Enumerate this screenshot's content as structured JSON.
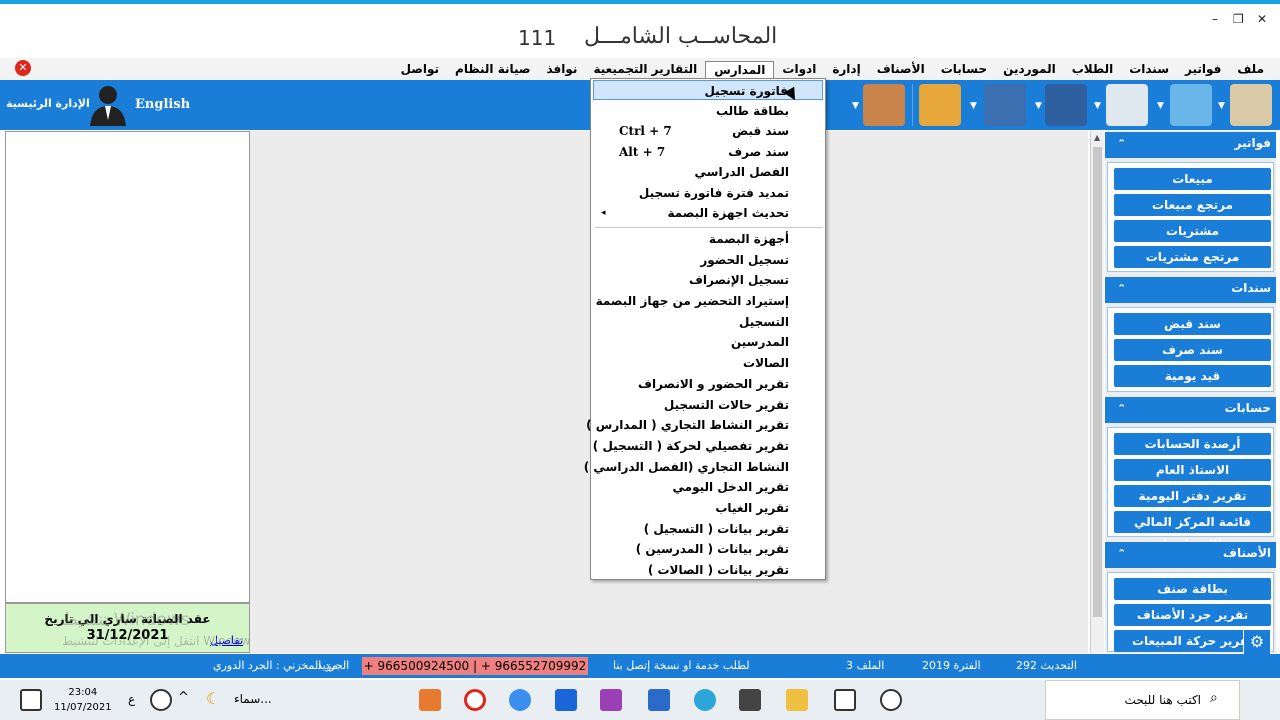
{
  "window": {
    "title": "المحاســب الشامـــل",
    "number": "111",
    "ctl_min": "–",
    "ctl_restore": "❐",
    "ctl_close": "✕"
  },
  "menubar": [
    "ملف",
    "فواتير",
    "سندات",
    "الطلاب",
    "الموردين",
    "حسابات",
    "الأصناف",
    "إدارة",
    "ادوات",
    "المدارس",
    "التقارير التجميعية",
    "نوافذ",
    "صيانة النظام",
    "تواصل"
  ],
  "active_menu": "المدارس",
  "toolbar": {
    "home_label": "الإدارة الرئيسية",
    "lang_label": "English"
  },
  "dropdown": {
    "items": [
      {
        "label": "فاتورة تسجيل",
        "highlighted": true
      },
      {
        "label": "بطاقة طالب"
      },
      {
        "label": "سند قبض",
        "shortcut": "Ctrl + 7"
      },
      {
        "label": "سند صرف",
        "shortcut": "Alt + 7"
      },
      {
        "label": "الفصل الدراسي"
      },
      {
        "label": "تمديد فترة فاتورة تسجيل"
      },
      {
        "label": "تحديث اجهزة البصمة",
        "submenu": "◂"
      },
      {
        "label": "أجهزة البصمة"
      },
      {
        "label": "تسجيل الحضور"
      },
      {
        "label": "تسجيل الإنصراف"
      },
      {
        "label": "إستيراد التحضير من جهاز البصمة"
      },
      {
        "label": "التسجيل"
      },
      {
        "label": "المدرسين"
      },
      {
        "label": "الصالات"
      },
      {
        "label": "تقرير الحضور و الانصراف"
      },
      {
        "label": "تقرير حالات التسجيل"
      },
      {
        "label": "تقرير النشاط التجاري ( المدارس )"
      },
      {
        "label": "تقرير تفصيلي لحركة ( التسجيل )"
      },
      {
        "label": "النشاط التجاري (الفصل الدراسي )"
      },
      {
        "label": "تقرير الدخل اليومي"
      },
      {
        "label": "تقرير الغياب"
      },
      {
        "label": "تقرير بيانات ( التسجيل )"
      },
      {
        "label": "تقرير بيانات ( المدرسين )"
      },
      {
        "label": "تقرير بيانات ( الصالات )"
      }
    ]
  },
  "side_sections": [
    {
      "title": "فواتير",
      "chevron": "⌃",
      "buttons": [
        "مبيعات",
        "مرتجع مبيعات",
        "مشتريات",
        "مرتجع مشتريات"
      ]
    },
    {
      "title": "سندات",
      "chevron": "⌃",
      "buttons": [
        "سند قبض",
        "سند صرف",
        "قيد يومية"
      ]
    },
    {
      "title": "حسابات",
      "chevron": "⌃",
      "buttons": [
        "أرصدة الحسابات",
        "الاستاذ العام",
        "تقرير دفتر اليومية",
        "قائمة المركز المالي (الميزانية)"
      ]
    },
    {
      "title": "الأصناف",
      "chevron": "⌃",
      "buttons": [
        "بطاقة صنف",
        "تقرير جرد الأصناف",
        "تقرير حركة المبيعات"
      ]
    }
  ],
  "notice": {
    "text": "عقد الصيانة ساري الي  تاريخ",
    "date": "31/12/2021",
    "link": "تفاصيل"
  },
  "watermark": {
    "line1": "تنشيط Windows",
    "line2": "انتقل إلى الإعدادات لتنشيط Windows."
  },
  "status": {
    "inventory": "الجرد المخزني : الجرد الدوري",
    "more": "مزيد",
    "phones": "+ 966500924500 | + 966552709992",
    "service": "لطلب خدمة او نسخة إتصل بنا",
    "file": "الملف 3",
    "period": "الفترة 2019",
    "update": "التحديث 292"
  },
  "taskbar": {
    "time": "23:04",
    "date": "11/07/2021",
    "lang": "ع",
    "weather": "سماء...",
    "search_placeholder": "اكتب هنا للبحث"
  },
  "colors": {
    "accent": "#1a7ed8",
    "notice_bg": "#d3f5c8",
    "phone_bg": "#f08080"
  }
}
